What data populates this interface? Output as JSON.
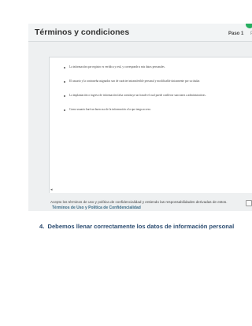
{
  "header": {
    "title": "Términos y condiciones",
    "step": "Paso 1",
    "next_step": "P"
  },
  "terms": [
    "La información que registro es verídica y real, y corresponde a mis datos personales.",
    "El usuario y la contraseña asignados son de carácter intransferible personal y modificable únicamente por su titular.",
    "La implantación o ingreso de información falsa constituye un fraude el cual puede conllevar sanciones a administrativas.",
    "Como usuario haré un buen uso de la información a la que tenga acceso."
  ],
  "accept": {
    "text": "Acepto los términos de uso y política de confidencialidad y entiendo las responsabilidades derivadas de estos."
  },
  "link": {
    "label": "Términos de Uso y Política de Confidencialidad"
  },
  "question": {
    "number": "4.",
    "text": "Debemos llenar correctamente los datos de información personal"
  },
  "colors": {
    "question_text": "#2a4b70",
    "link": "#3a6b86",
    "status_ok": "#27ae60"
  }
}
